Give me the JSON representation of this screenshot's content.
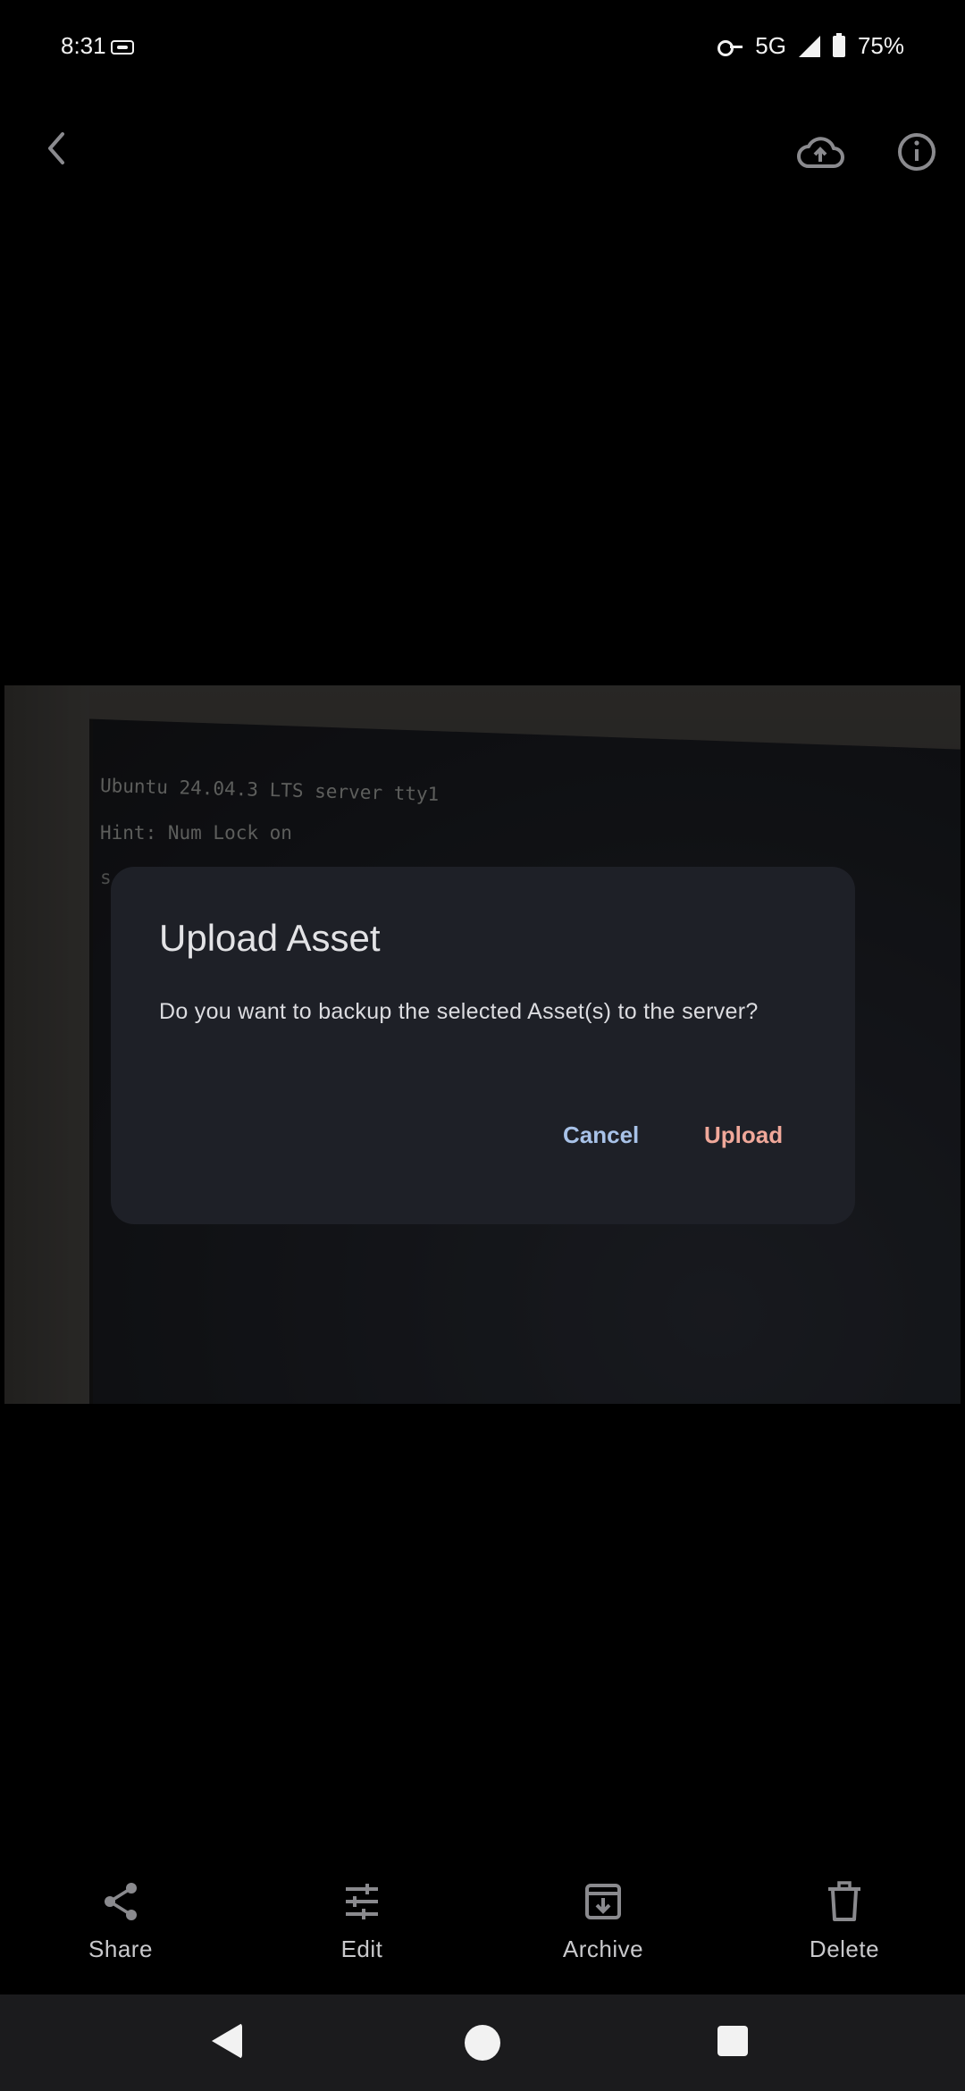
{
  "status_bar": {
    "time": "8:31",
    "network": "5G",
    "battery": "75%"
  },
  "top_bar": {
    "back_icon": "chevron-left-icon",
    "upload_icon": "cloud-upload-icon",
    "info_icon": "info-icon"
  },
  "photo": {
    "terminal_lines": [
      "Ubuntu 24.04.3 LTS server tty1",
      "Hint: Num Lock on",
      "s"
    ]
  },
  "dialog": {
    "title": "Upload Asset",
    "message": "Do you want to backup the selected Asset(s) to the server?",
    "cancel_label": "Cancel",
    "upload_label": "Upload"
  },
  "actions": {
    "share": "Share",
    "edit": "Edit",
    "archive": "Archive",
    "delete": "Delete"
  },
  "colors": {
    "dialog_bg": "#1e2027",
    "cancel_text": "#a8c2e8",
    "upload_text": "#f0a89a"
  }
}
